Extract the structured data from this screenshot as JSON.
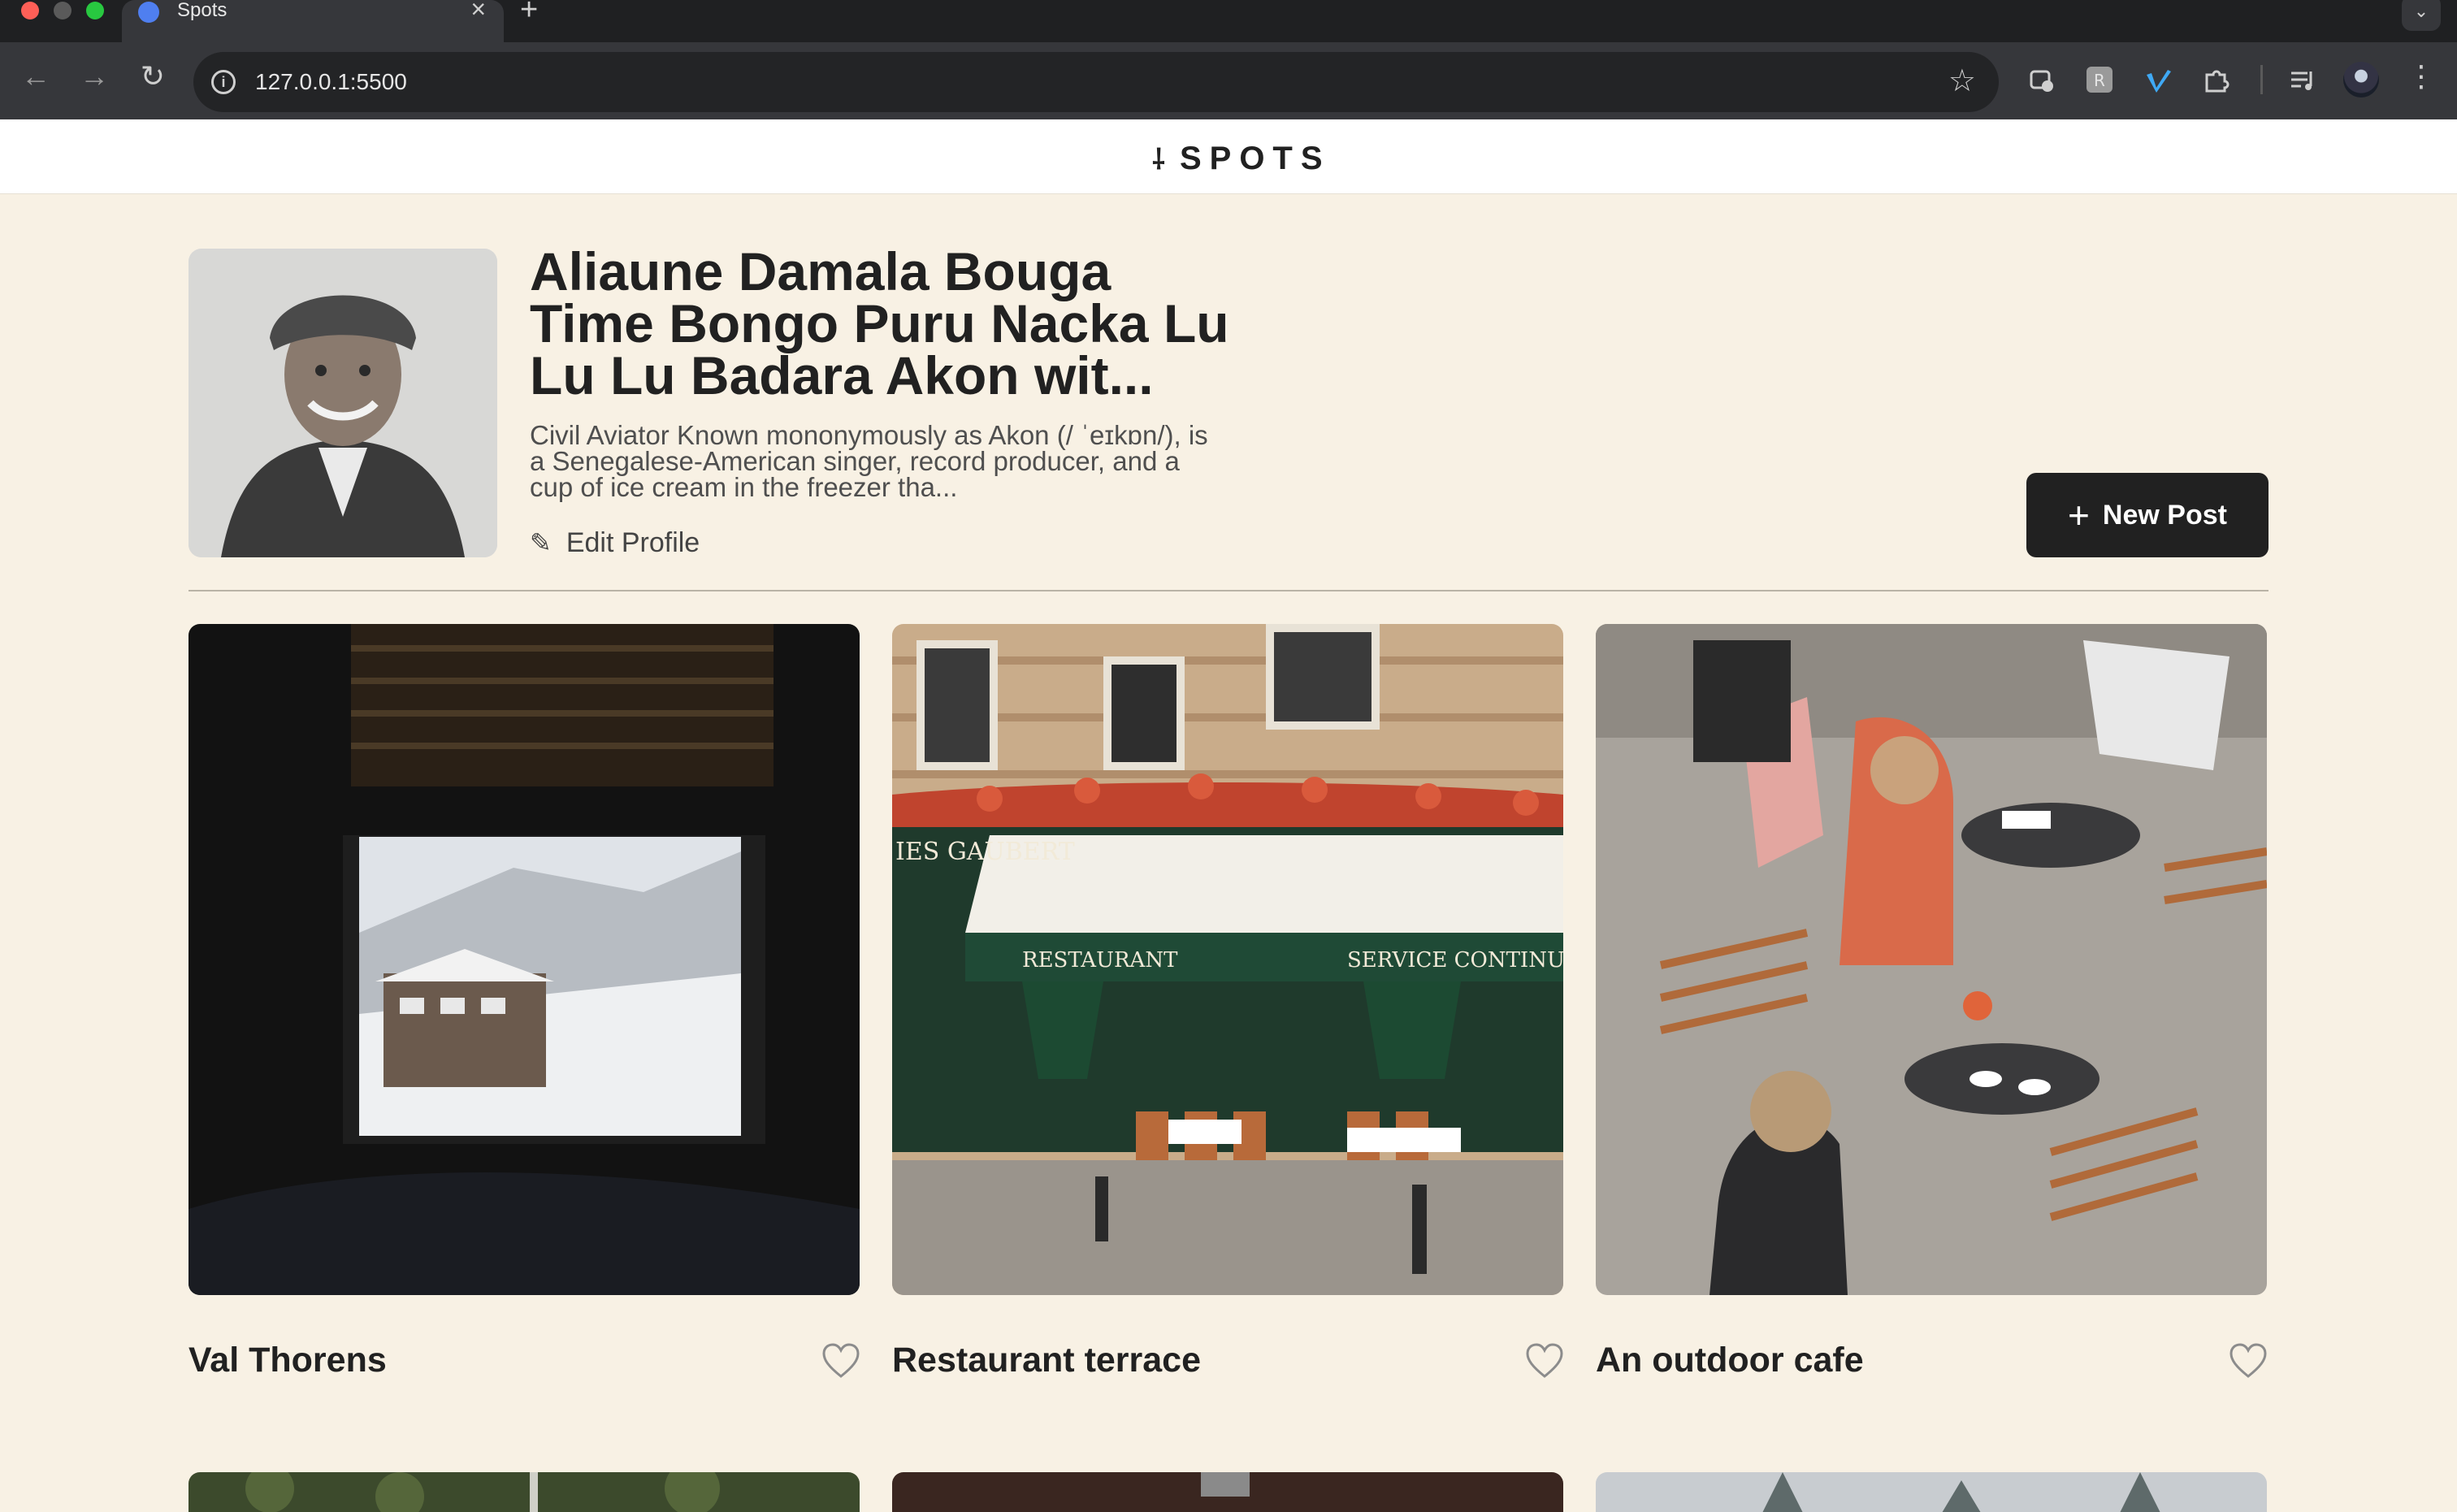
{
  "browser": {
    "tab_title": "Spots",
    "tab_close": "×",
    "new_tab": "+",
    "tab_menu": "⌄",
    "back": "←",
    "forward": "→",
    "reload": "↻",
    "info": "i",
    "url": "127.0.0.1:5500",
    "bookmark": "☆",
    "menu": "⋮"
  },
  "site": {
    "logo_mark": "⸸",
    "logo_text": "SPOTS"
  },
  "profile": {
    "name": "Aliaune Damala Bouga Time Bongo Puru Nacka Lu Lu Lu Badara Akon wit...",
    "description": "Civil Aviator Known mononymously as Akon (/ ˈeɪkɒn/), is a Senegalese-American singer, record producer, and a cup of ice cream in the freezer tha...",
    "edit_icon": "✎",
    "edit_label": "Edit Profile",
    "new_post_icon": "+",
    "new_post_label": "New Post"
  },
  "cards": [
    {
      "title": "Val Thorens"
    },
    {
      "title": "Restaurant terrace"
    },
    {
      "title": "An outdoor cafe"
    }
  ],
  "colors": {
    "page_bg": "#f8f1e4",
    "text": "#212121",
    "button_bg": "#212121"
  }
}
